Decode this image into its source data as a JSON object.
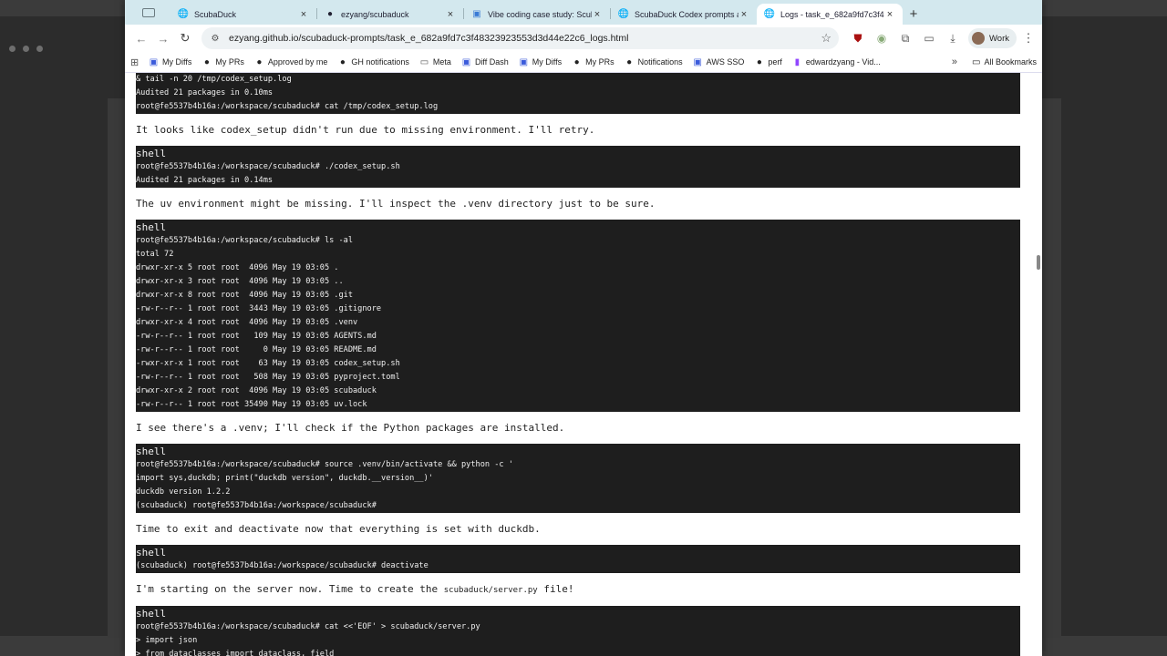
{
  "tabs": [
    {
      "title": "ScubaDuck",
      "icon": "globe-icon",
      "active": false
    },
    {
      "title": "ezyang/scubaduck",
      "icon": "github-icon",
      "active": false
    },
    {
      "title": "Vibe coding case study: Scub",
      "icon": "doc-icon",
      "active": false
    },
    {
      "title": "ScubaDuck Codex prompts a",
      "icon": "globe-icon",
      "active": false
    },
    {
      "title": "Logs - task_e_682a9fd7c3f4",
      "icon": "globe-icon",
      "active": true
    }
  ],
  "toolbar": {
    "url": "ezyang.github.io/scubaduck-prompts/task_e_682a9fd7c3f48323923553d3d44e22c6_logs.html",
    "profile_label": "Work"
  },
  "bookmarks": {
    "items": [
      {
        "label": "My Diffs",
        "icon": "meta-icon"
      },
      {
        "label": "My PRs",
        "icon": "github-icon"
      },
      {
        "label": "Approved by me",
        "icon": "github-icon"
      },
      {
        "label": "GH notifications",
        "icon": "github-icon"
      },
      {
        "label": "Meta",
        "icon": "folder-icon"
      },
      {
        "label": "Diff Dash",
        "icon": "diff-icon"
      },
      {
        "label": "My Diffs",
        "icon": "meta-icon"
      },
      {
        "label": "My PRs",
        "icon": "github-icon"
      },
      {
        "label": "Notifications",
        "icon": "github-icon"
      },
      {
        "label": "AWS SSO",
        "icon": "aws-icon"
      },
      {
        "label": "perf",
        "icon": "github-icon"
      },
      {
        "label": "edwardzyang - Vid...",
        "icon": "twitch-icon"
      }
    ],
    "all_label": "All Bookmarks"
  },
  "log": {
    "t1_lines": [
      "& tail -n 20 /tmp/codex_setup.log",
      "Audited 21 packages in 0.10ms",
      "root@fe5537b4b16a:/workspace/scubaduck# cat /tmp/codex_setup.log"
    ],
    "p1": "It looks like codex_setup didn't run due to missing environment. I'll retry.",
    "t2_hdr": "shell",
    "t2_lines": [
      "root@fe5537b4b16a:/workspace/scubaduck# ./codex_setup.sh",
      "Audited 21 packages in 0.14ms"
    ],
    "p2": "The uv environment might be missing. I'll inspect the .venv directory just to be sure.",
    "t3_hdr": "shell",
    "t3_lines": [
      "root@fe5537b4b16a:/workspace/scubaduck# ls -al",
      "total 72",
      "drwxr-xr-x 5 root root  4096 May 19 03:05 .",
      "drwxr-xr-x 3 root root  4096 May 19 03:05 ..",
      "drwxr-xr-x 8 root root  4096 May 19 03:05 .git",
      "-rw-r--r-- 1 root root  3443 May 19 03:05 .gitignore",
      "drwxr-xr-x 4 root root  4096 May 19 03:05 .venv",
      "-rw-r--r-- 1 root root   109 May 19 03:05 AGENTS.md",
      "-rw-r--r-- 1 root root     0 May 19 03:05 README.md",
      "-rwxr-xr-x 1 root root    63 May 19 03:05 codex_setup.sh",
      "-rw-r--r-- 1 root root   508 May 19 03:05 pyproject.toml",
      "drwxr-xr-x 2 root root  4096 May 19 03:05 scubaduck",
      "-rw-r--r-- 1 root root 35490 May 19 03:05 uv.lock"
    ],
    "p3": "I see there's a .venv; I'll check if the Python packages are installed.",
    "t4_hdr": "shell",
    "t4_lines": [
      "root@fe5537b4b16a:/workspace/scubaduck# source .venv/bin/activate && python -c '",
      "import sys,duckdb; print(\"duckdb version\", duckdb.__version__)'",
      "duckdb version 1.2.2",
      "(scubaduck) root@fe5537b4b16a:/workspace/scubaduck#"
    ],
    "p4": "Time to exit and deactivate now that everything is set with duckdb.",
    "t5_hdr": "shell",
    "t5_lines": [
      "(scubaduck) root@fe5537b4b16a:/workspace/scubaduck# deactivate"
    ],
    "p5_pre": "I'm starting on the server now. Time to create the ",
    "p5_code": "scubaduck/server.py",
    "p5_post": " file!",
    "t6_hdr": "shell",
    "t6_lines": [
      "root@fe5537b4b16a:/workspace/scubaduck# cat <<'EOF' > scubaduck/server.py",
      "> import json",
      "> from dataclasses import dataclass, field"
    ]
  }
}
